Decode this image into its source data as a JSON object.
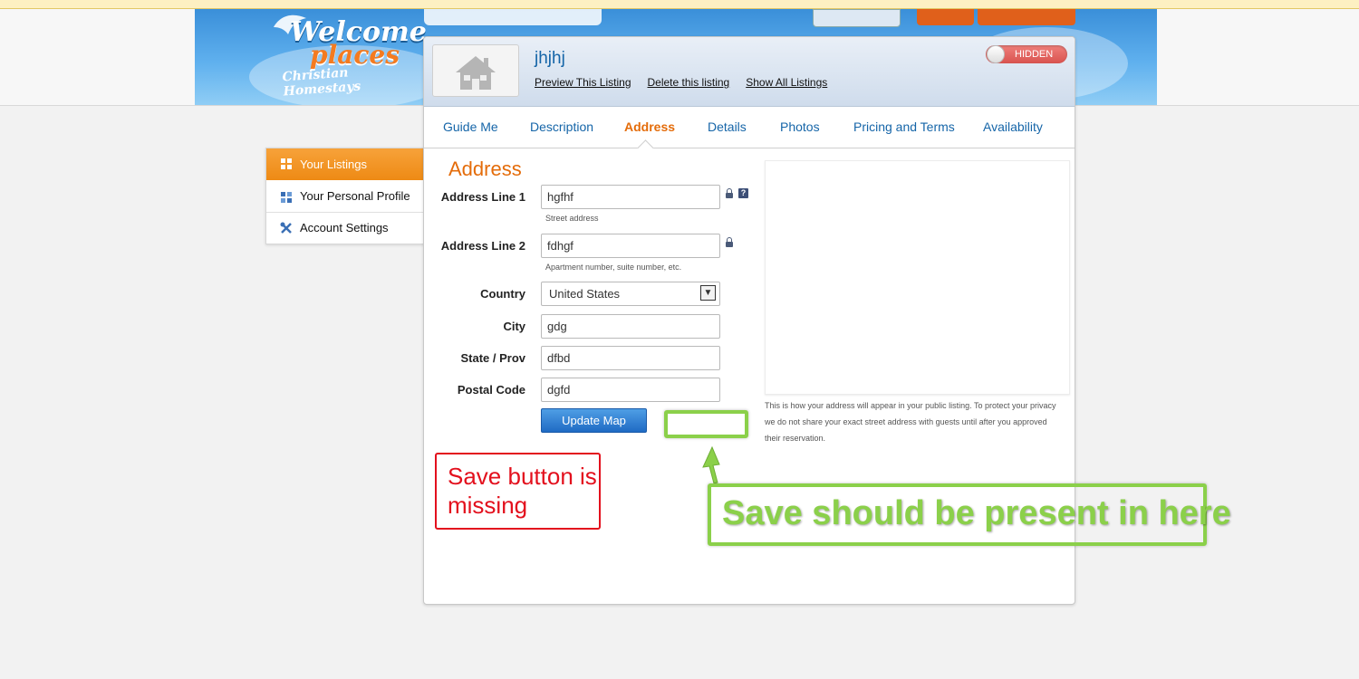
{
  "logo": {
    "line1": "Welcome",
    "line2": "places",
    "tagline": "Christian Homestays"
  },
  "listing": {
    "title": "jhjhj",
    "links": [
      "Preview This Listing",
      "Delete this listing",
      "Show All Listings"
    ],
    "visibility_toggle": "HIDDEN"
  },
  "tabs": [
    {
      "label": "Guide Me",
      "active": false
    },
    {
      "label": "Description",
      "active": false
    },
    {
      "label": "Address",
      "active": true
    },
    {
      "label": "Details",
      "active": false
    },
    {
      "label": "Photos",
      "active": false
    },
    {
      "label": "Pricing and Terms",
      "active": false
    },
    {
      "label": "Availability",
      "active": false
    }
  ],
  "side_menu": [
    {
      "label": "Your Listings",
      "active": true,
      "icon": "grid-icon"
    },
    {
      "label": "Your Personal Profile",
      "active": false,
      "icon": "grid-icon"
    },
    {
      "label": "Account Settings",
      "active": false,
      "icon": "tools-icon"
    }
  ],
  "address_form": {
    "section_title": "Address",
    "fields": {
      "address_line_1": {
        "label": "Address Line 1",
        "value": "hgfhf",
        "hint": "Street address"
      },
      "address_line_2": {
        "label": "Address Line 2",
        "value": "fdhgf",
        "hint": "Apartment number, suite number, etc."
      },
      "country": {
        "label": "Country",
        "value": "United States"
      },
      "city": {
        "label": "City",
        "value": "gdg"
      },
      "state": {
        "label": "State / Prov",
        "value": "dfbd"
      },
      "postal_code": {
        "label": "Postal Code",
        "value": "dgfd"
      }
    },
    "help_icon_text": "?",
    "dropdown_arrow": "▼",
    "update_button": "Update Map"
  },
  "map_note": "This is how your address will appear in your public listing. To protect your privacy we do not share your exact street address with guests until after you approved their reservation.",
  "annotations": {
    "red_note": "Save button is missing",
    "green_note": "Save should be present in here"
  },
  "colors": {
    "accent_orange": "#e46c0a",
    "link_blue": "#1565a8",
    "annotation_red": "#e3101d",
    "annotation_green": "#8bd04a"
  }
}
